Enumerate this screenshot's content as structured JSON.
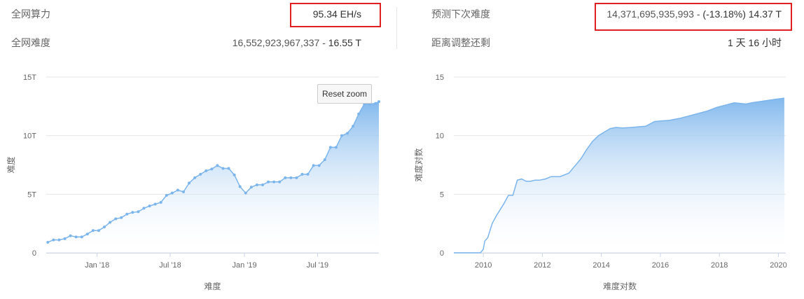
{
  "stats": {
    "hashrate": {
      "label": "全网算力",
      "value": "95.34 EH/s"
    },
    "difficulty": {
      "label": "全网难度",
      "value_full": "16,552,923,967,337",
      "sep": " - ",
      "value_short": "16.55 T"
    },
    "predicted": {
      "label": "预测下次难度",
      "value_full": "14,371,695,935,993",
      "sep": " - ",
      "change": "(-13.18%)",
      "value_short": "14.37 T"
    },
    "remaining": {
      "label": "距离调整还剩",
      "value": "1 天 16 小时"
    }
  },
  "colors": {
    "highlight": "#e02020",
    "series_line": "#7cb5ec",
    "series_fill_top": "#7cb5ec",
    "grid": "#e6e6e6"
  },
  "reset_zoom_label": "Reset zoom",
  "chart_data": [
    {
      "type": "area",
      "xlabel": "难度",
      "ylabel": "难度",
      "ylim": [
        0,
        15
      ],
      "y_ticks": [
        "0",
        "5T",
        "10T",
        "15T"
      ],
      "x_ticks": [
        "Jan '18",
        "Jul '18",
        "Jan '19",
        "Jul '19"
      ],
      "grid": true,
      "markers": true,
      "series": [
        {
          "x": [
            "2017-09-01",
            "2017-09-15",
            "2017-09-29",
            "2017-10-13",
            "2017-10-27",
            "2017-11-10",
            "2017-11-24",
            "2017-12-08",
            "2017-12-22",
            "2018-01-05",
            "2018-01-19",
            "2018-02-02",
            "2018-02-16",
            "2018-03-02",
            "2018-03-16",
            "2018-03-30",
            "2018-04-13",
            "2018-04-27",
            "2018-05-11",
            "2018-05-25",
            "2018-06-08",
            "2018-06-22",
            "2018-07-06",
            "2018-07-20",
            "2018-08-03",
            "2018-08-17",
            "2018-08-31",
            "2018-09-14",
            "2018-09-28",
            "2018-10-12",
            "2018-10-26",
            "2018-11-09",
            "2018-11-23",
            "2018-12-07",
            "2018-12-21",
            "2019-01-04",
            "2019-01-18",
            "2019-02-01",
            "2019-02-15",
            "2019-03-01",
            "2019-03-15",
            "2019-03-29",
            "2019-04-12",
            "2019-04-26",
            "2019-05-10",
            "2019-05-24",
            "2019-06-07",
            "2019-06-21",
            "2019-07-05",
            "2019-07-19",
            "2019-08-02",
            "2019-08-16",
            "2019-08-30",
            "2019-09-13",
            "2019-09-27",
            "2019-10-11",
            "2019-10-25",
            "2019-11-08",
            "2019-11-22",
            "2019-11-30"
          ],
          "values": [
            0.9,
            1.1,
            1.1,
            1.2,
            1.45,
            1.35,
            1.35,
            1.6,
            1.9,
            1.9,
            2.2,
            2.6,
            2.9,
            3.0,
            3.3,
            3.45,
            3.5,
            3.8,
            4.0,
            4.15,
            4.3,
            4.9,
            5.1,
            5.35,
            5.2,
            5.95,
            6.4,
            6.7,
            7.0,
            7.15,
            7.45,
            7.2,
            7.2,
            6.65,
            5.65,
            5.1,
            5.6,
            5.8,
            5.8,
            6.05,
            6.05,
            6.05,
            6.4,
            6.4,
            6.4,
            6.7,
            6.7,
            7.45,
            7.45,
            7.95,
            9.0,
            9.0,
            10.0,
            10.2,
            10.8,
            11.85,
            12.7,
            12.7,
            12.75,
            12.9
          ]
        }
      ]
    },
    {
      "type": "area",
      "xlabel": "难度对数",
      "ylabel": "难度对数",
      "ylim": [
        0,
        15
      ],
      "y_ticks": [
        "0",
        "5",
        "10",
        "15"
      ],
      "x_ticks": [
        "2010",
        "2012",
        "2014",
        "2016",
        "2018",
        "2020"
      ],
      "grid": true,
      "markers": false,
      "series": [
        {
          "x": [
            2009.0,
            2009.9,
            2010.0,
            2010.05,
            2010.15,
            2010.3,
            2010.45,
            2010.55,
            2010.7,
            2010.85,
            2011.0,
            2011.15,
            2011.3,
            2011.45,
            2011.6,
            2011.75,
            2011.9,
            2012.1,
            2012.3,
            2012.6,
            2012.9,
            2013.1,
            2013.3,
            2013.5,
            2013.7,
            2013.9,
            2014.1,
            2014.3,
            2014.5,
            2014.7,
            2015.0,
            2015.5,
            2015.8,
            2016.0,
            2016.3,
            2016.7,
            2017.0,
            2017.3,
            2017.6,
            2017.9,
            2018.2,
            2018.5,
            2018.9,
            2019.1,
            2019.5,
            2019.9,
            2020.2
          ],
          "values": [
            0.0,
            0.0,
            0.3,
            1.0,
            1.3,
            2.5,
            3.2,
            3.6,
            4.2,
            4.9,
            4.9,
            6.2,
            6.3,
            6.1,
            6.1,
            6.2,
            6.2,
            6.3,
            6.5,
            6.5,
            6.8,
            7.4,
            8.0,
            8.8,
            9.5,
            10.0,
            10.3,
            10.6,
            10.7,
            10.65,
            10.7,
            10.8,
            11.2,
            11.25,
            11.3,
            11.5,
            11.7,
            11.9,
            12.1,
            12.4,
            12.6,
            12.8,
            12.7,
            12.8,
            12.95,
            13.1,
            13.2
          ]
        }
      ]
    }
  ]
}
